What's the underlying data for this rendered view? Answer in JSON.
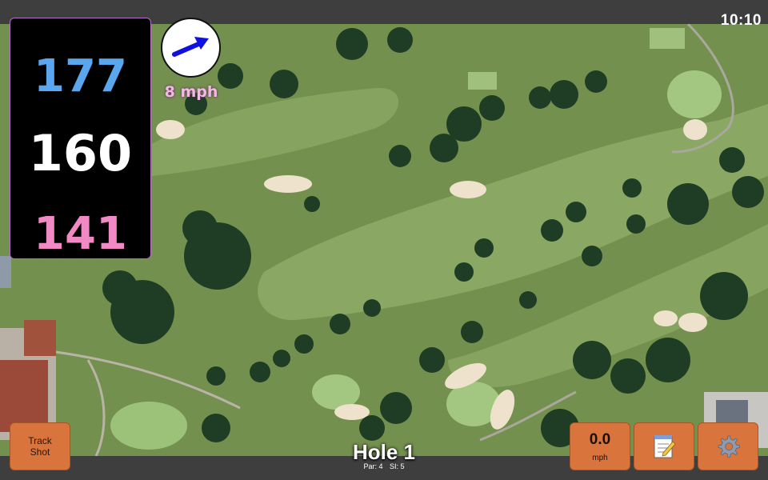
{
  "status_bar": {
    "time": "10:10"
  },
  "distances": {
    "back": "177",
    "center": "160",
    "front": "141"
  },
  "wind": {
    "speed_label": "8 mph",
    "icon": "wind-arrow-icon",
    "direction": "north-east"
  },
  "hole": {
    "title": "Hole 1",
    "par_label": "Par: 4",
    "si_label": "SI: 5"
  },
  "buttons": {
    "track_shot_line1": "Track",
    "track_shot_line2": "Shot",
    "speed_value": "0.0",
    "speed_unit": "mph",
    "notes_icon": "notepad-icon",
    "settings_icon": "gear-icon"
  },
  "colors": {
    "back_distance": "#5aa7f0",
    "center_distance": "#ffffff",
    "front_distance": "#f089c4",
    "button_accent": "#d8743c"
  }
}
